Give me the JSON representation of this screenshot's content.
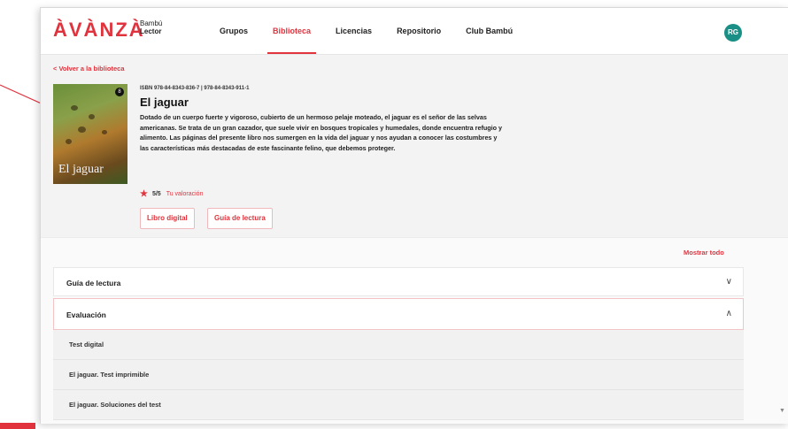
{
  "header": {
    "logo": "ÀVÀNZÀ",
    "logo_sub_top": "Bambú",
    "logo_sub_bottom": "Lector",
    "nav": [
      "Grupos",
      "Biblioteca",
      "Licencias",
      "Repositorio",
      "Club Bambú"
    ],
    "active_nav": "Biblioteca",
    "avatar": "RG"
  },
  "book": {
    "back_link": "< Volver a la biblioteca",
    "isbn": "ISBN 978-84-8343-836-7 | 978-84-8343-911-1",
    "title": "El jaguar",
    "cover_title": "El jaguar",
    "cover_badge": "8",
    "description": "Dotado de un cuerpo fuerte y vigoroso, cubierto de un hermoso pelaje moteado, el jaguar es el señor de las selvas americanas. Se trata de un gran cazador, que suele vivir en bosques tropicales y humedales, donde encuentra refugio y alimento. Las páginas del presente libro nos sumergen en la vida del jaguar y nos ayudan a conocer las costumbres y las características más destacadas de este fascinante felino, que debemos proteger.",
    "rating": "5/5",
    "rating_link": "Tu valoración",
    "buttons": [
      "Libro digital",
      "Guía de lectura"
    ]
  },
  "resources": {
    "show_all": "Mostrar todo",
    "sections": [
      {
        "label": "Guía de lectura",
        "chevron": "∨"
      },
      {
        "label": "Evaluación",
        "chevron": "∧"
      }
    ],
    "evaluation_items": [
      "Test digital",
      "El jaguar. Test imprimible",
      "El jaguar. Soluciones del test"
    ]
  },
  "colors": {
    "accent": "#e0333d",
    "avatar": "#1a8f86"
  }
}
